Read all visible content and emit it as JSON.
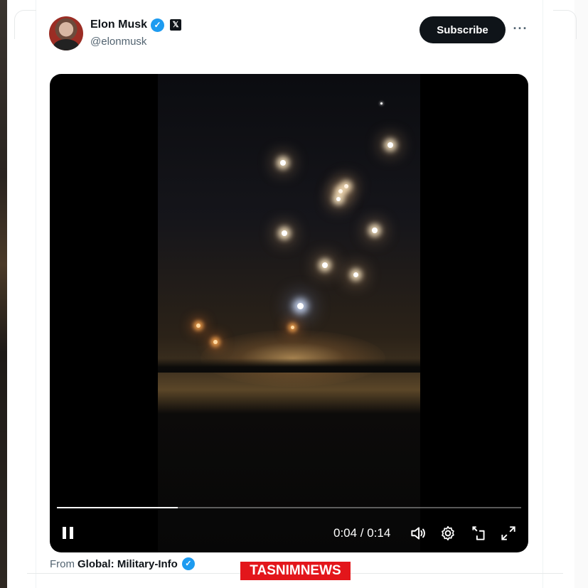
{
  "author": {
    "name": "Elon Musk",
    "handle": "@elonmusk",
    "badge_color": "#1d9bf0",
    "affiliate_badge": "𝕏"
  },
  "header": {
    "subscribe_label": "Subscribe",
    "more_label": "···"
  },
  "video": {
    "time_label": "0:04 / 0:14",
    "progress": 0.26,
    "state": "playing",
    "controls": [
      "pause-icon",
      "volume-icon",
      "settings-icon",
      "picture-in-picture-icon",
      "fullscreen-icon"
    ]
  },
  "attribution": {
    "prefix": "From",
    "source_name": "Global: Military-Info"
  },
  "watermark": {
    "text": "TASNIMNEWS",
    "color": "#e3161b"
  },
  "colors": {
    "accent": "#1d9bf0",
    "text_primary": "#0f1419",
    "text_secondary": "#536471"
  }
}
